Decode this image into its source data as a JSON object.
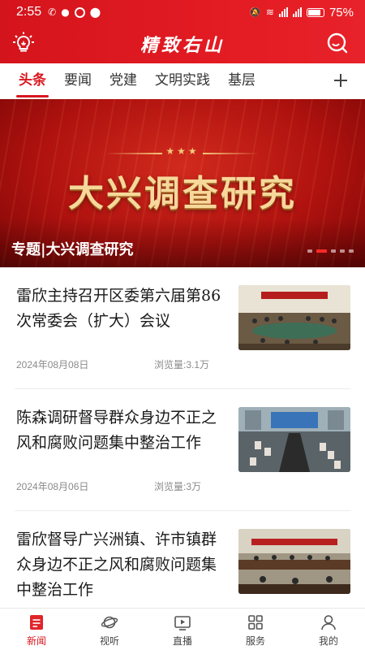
{
  "status_bar": {
    "time": "2:55",
    "battery_pct": "75%",
    "battery_level": 0.75
  },
  "header": {
    "title": "精致右山",
    "left_icon": "lightbulb-icon",
    "right_icon": "search-icon"
  },
  "tabs": {
    "items": [
      "头条",
      "要闻",
      "党建",
      "文明实践",
      "基层"
    ],
    "active": "头条",
    "add_icon": "plus-icon"
  },
  "banner": {
    "headline": "大兴调查研究",
    "caption": "专题|大兴调查研究",
    "stars": "★★★",
    "slide_count": 5,
    "active_slide": 2
  },
  "news": [
    {
      "title": "雷欣主持召开区委第六届第86次常委会（扩大）会议",
      "date": "2024年08月08日",
      "views": "浏览量:3.1万",
      "image_desc": "meeting room"
    },
    {
      "title": "陈森调研督导群众身边不正之风和腐败问题集中整治工作",
      "date": "2024年08月06日",
      "views": "浏览量:3万",
      "image_desc": "conference"
    },
    {
      "title": "雷欣督导广兴洲镇、许市镇群众身边不正之风和腐败问题集中整治工作",
      "date": "",
      "views": "",
      "image_desc": "meeting"
    }
  ],
  "bottom_nav": [
    {
      "label": "新闻",
      "icon": "news-icon",
      "active": true
    },
    {
      "label": "视听",
      "icon": "planet-icon",
      "active": false
    },
    {
      "label": "直播",
      "icon": "live-tv-icon",
      "active": false
    },
    {
      "label": "服务",
      "icon": "grid-icon",
      "active": false
    },
    {
      "label": "我的",
      "icon": "user-icon",
      "active": false
    }
  ],
  "colors": {
    "brand_red": "#d9161e",
    "banner_gold": "#f6d89a",
    "meta_gray": "#8a8a8a"
  }
}
